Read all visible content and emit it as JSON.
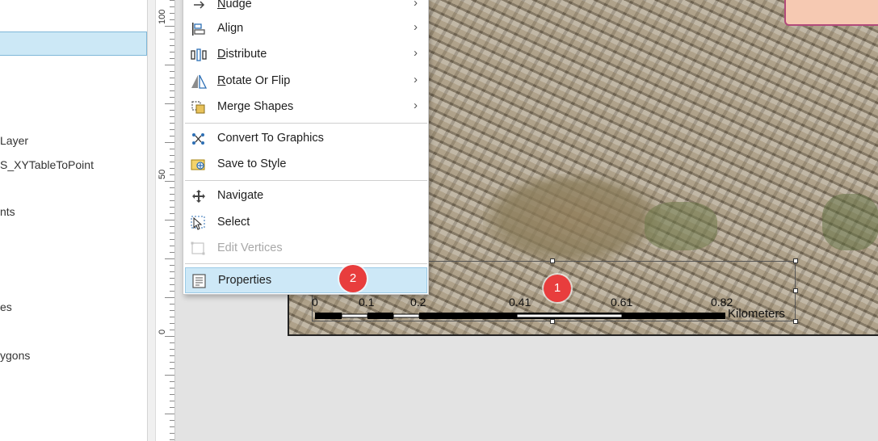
{
  "contents_pane": {
    "items": [
      {
        "label": "Layer"
      },
      {
        "label": "S_XYTableToPoint"
      },
      {
        "label": "nts"
      },
      {
        "label": "es"
      },
      {
        "label": "ygons"
      }
    ]
  },
  "ruler": {
    "labels": [
      "100",
      "50",
      "0"
    ]
  },
  "context_menu": {
    "items": [
      {
        "label": "Nudge",
        "accel": "N",
        "rest": "udge",
        "icon": "nudge-icon",
        "submenu": true
      },
      {
        "label": "Align",
        "icon": "align-icon",
        "submenu": true
      },
      {
        "label": "Distribute",
        "accel": "D",
        "rest": "istribute",
        "icon": "distribute-icon",
        "submenu": true
      },
      {
        "label": "Rotate Or Flip",
        "accel": "R",
        "rest": "otate Or Flip",
        "icon": "rotate-flip-icon",
        "submenu": true
      },
      {
        "label": "Merge Shapes",
        "icon": "merge-shapes-icon",
        "submenu": true
      },
      {
        "label": "Convert To Graphics",
        "icon": "convert-graphics-icon"
      },
      {
        "label": "Save to Style",
        "icon": "save-style-icon"
      },
      {
        "label": "Navigate",
        "icon": "navigate-icon"
      },
      {
        "label": "Select",
        "icon": "select-icon"
      },
      {
        "label": "Edit Vertices",
        "icon": "edit-vertices-icon",
        "disabled": true
      },
      {
        "label": "Properties",
        "icon": "properties-icon",
        "highlighted": true
      }
    ],
    "submenu_arrow": "›"
  },
  "scale_bar": {
    "labels": [
      "0",
      "0.1",
      "0.2",
      "0.41",
      "0.61",
      "0.82"
    ],
    "units": "Kilometers"
  },
  "annotations": {
    "step1": "1",
    "step2": "2"
  },
  "colors": {
    "highlight": "#cde8f7",
    "badge": "#e83d3d",
    "selection": "#cce8f6"
  }
}
